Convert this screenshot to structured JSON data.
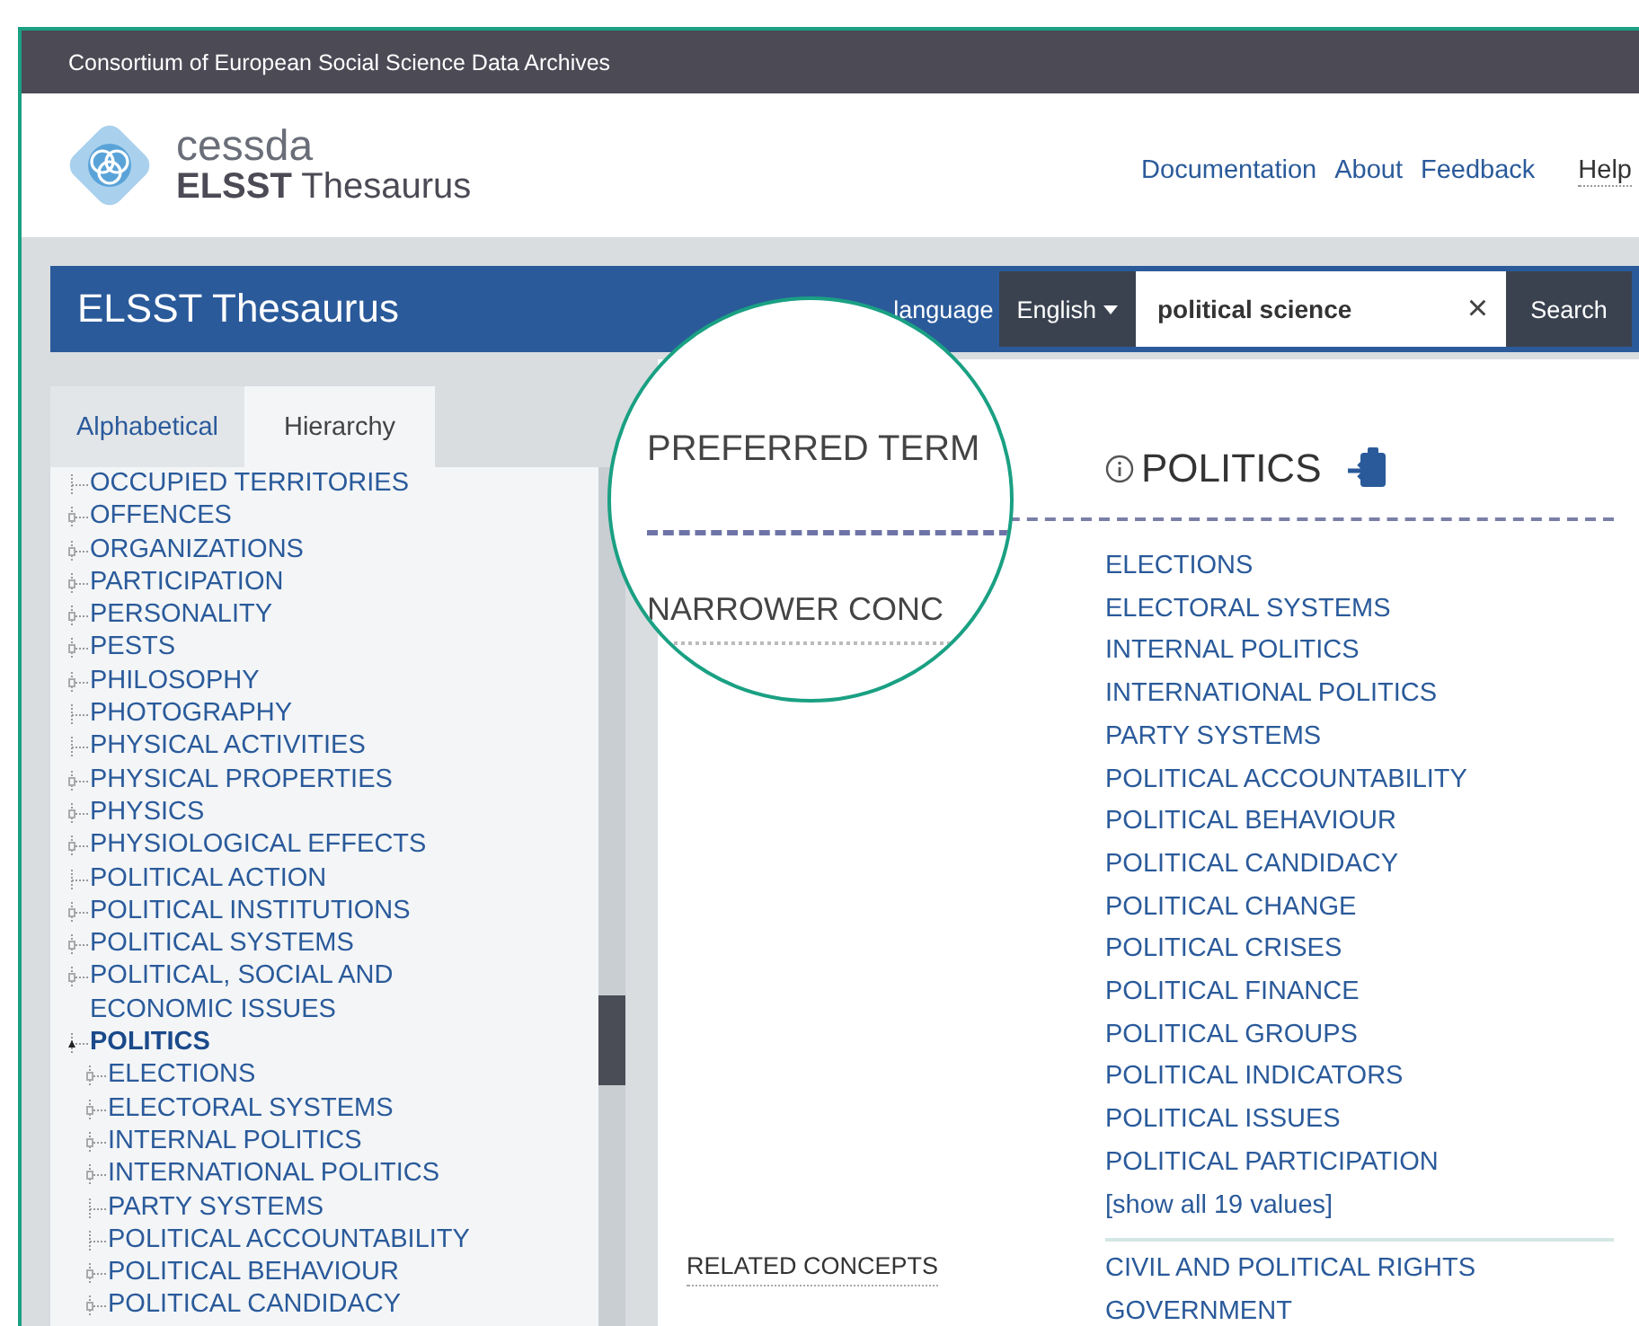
{
  "top_bar": {
    "title": "Consortium of European Social Science Data Archives"
  },
  "header": {
    "logo_top": "cessda",
    "logo_bold": "ELSST",
    "logo_rest": "Thesaurus",
    "nav": [
      {
        "label": "Documentation",
        "kind": "link"
      },
      {
        "label": "About",
        "kind": "link"
      },
      {
        "label": "Feedback",
        "kind": "link"
      },
      {
        "label": "Help",
        "kind": "menu"
      }
    ]
  },
  "title_bar": {
    "title": "ELSST Thesaurus",
    "language_label": "language",
    "language": "English",
    "search": {
      "value": "political science",
      "clear": "×",
      "button": "Search"
    }
  },
  "tabs": [
    {
      "label": "Alphabetical",
      "selected": false
    },
    {
      "label": "Hierarchy",
      "selected": true
    }
  ],
  "tree": [
    {
      "label": "OCCUPIED TERRITORIES",
      "has_children": false,
      "expanded": false,
      "selected": false
    },
    {
      "label": "OFFENCES",
      "has_children": true,
      "expanded": false,
      "selected": false
    },
    {
      "label": "ORGANIZATIONS",
      "has_children": true,
      "expanded": false,
      "selected": false
    },
    {
      "label": "PARTICIPATION",
      "has_children": true,
      "expanded": false,
      "selected": false
    },
    {
      "label": "PERSONALITY",
      "has_children": true,
      "expanded": false,
      "selected": false
    },
    {
      "label": "PESTS",
      "has_children": true,
      "expanded": false,
      "selected": false
    },
    {
      "label": "PHILOSOPHY",
      "has_children": true,
      "expanded": false,
      "selected": false
    },
    {
      "label": "PHOTOGRAPHY",
      "has_children": false,
      "expanded": false,
      "selected": false
    },
    {
      "label": "PHYSICAL ACTIVITIES",
      "has_children": false,
      "expanded": false,
      "selected": false
    },
    {
      "label": "PHYSICAL PROPERTIES",
      "has_children": true,
      "expanded": false,
      "selected": false
    },
    {
      "label": "PHYSICS",
      "has_children": true,
      "expanded": false,
      "selected": false
    },
    {
      "label": "PHYSIOLOGICAL EFFECTS",
      "has_children": true,
      "expanded": false,
      "selected": false
    },
    {
      "label": "POLITICAL ACTION",
      "has_children": false,
      "expanded": false,
      "selected": false
    },
    {
      "label": "POLITICAL INSTITUTIONS",
      "has_children": true,
      "expanded": false,
      "selected": false
    },
    {
      "label": "POLITICAL SYSTEMS",
      "has_children": true,
      "expanded": false,
      "selected": false
    },
    {
      "label": "POLITICAL, SOCIAL AND ECONOMIC ISSUES",
      "has_children": true,
      "expanded": false,
      "selected": false
    },
    {
      "label": "POLITICS",
      "has_children": true,
      "expanded": true,
      "selected": true,
      "children": [
        {
          "label": "ELECTIONS",
          "has_children": true,
          "expanded": false,
          "selected": false
        },
        {
          "label": "ELECTORAL SYSTEMS",
          "has_children": true,
          "expanded": false,
          "selected": false
        },
        {
          "label": "INTERNAL POLITICS",
          "has_children": true,
          "expanded": false,
          "selected": false
        },
        {
          "label": "INTERNATIONAL POLITICS",
          "has_children": true,
          "expanded": false,
          "selected": false
        },
        {
          "label": "PARTY SYSTEMS",
          "has_children": false,
          "expanded": false,
          "selected": false
        },
        {
          "label": "POLITICAL ACCOUNTABILITY",
          "has_children": false,
          "expanded": false,
          "selected": false
        },
        {
          "label": "POLITICAL BEHAVIOUR",
          "has_children": true,
          "expanded": false,
          "selected": false
        },
        {
          "label": "POLITICAL CANDIDACY",
          "has_children": true,
          "expanded": false,
          "selected": false
        }
      ]
    }
  ],
  "concept": {
    "preferred_label": "PREFERRED TERM",
    "term": "POLITICS",
    "narrower_label": "NARROWER CONC",
    "narrower": [
      "ELECTIONS",
      "ELECTORAL SYSTEMS",
      "INTERNAL POLITICS",
      "INTERNATIONAL POLITICS",
      "PARTY SYSTEMS",
      "POLITICAL ACCOUNTABILITY",
      "POLITICAL BEHAVIOUR",
      "POLITICAL CANDIDACY",
      "POLITICAL CHANGE",
      "POLITICAL CRISES",
      "POLITICAL FINANCE",
      "POLITICAL GROUPS",
      "POLITICAL INDICATORS",
      "POLITICAL ISSUES",
      "POLITICAL PARTICIPATION"
    ],
    "show_all": "[show all 19 values]",
    "related_label": "RELATED CONCEPTS",
    "related": [
      "CIVIL AND POLITICAL RIGHTS",
      "GOVERNMENT"
    ]
  }
}
